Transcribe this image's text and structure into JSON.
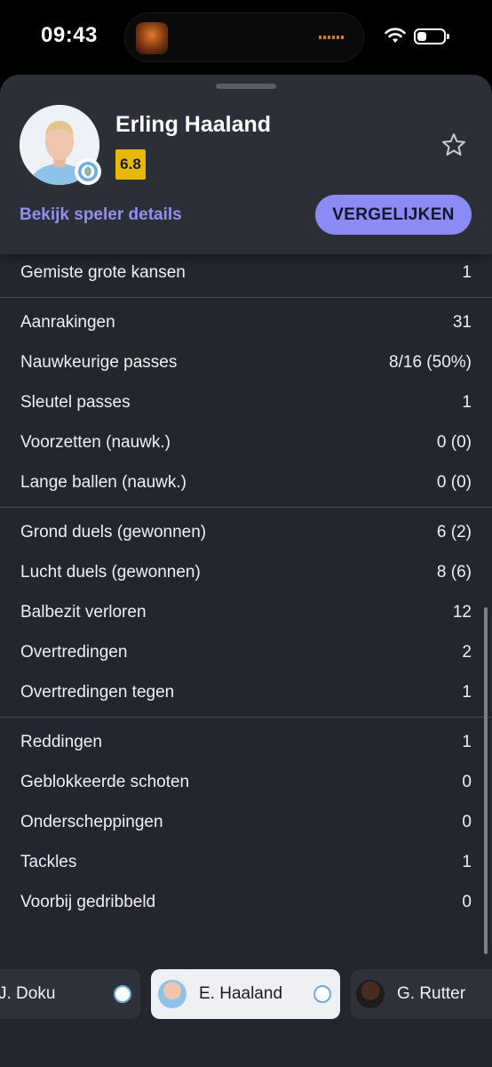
{
  "status_bar": {
    "time": "09:43",
    "battery_level": 0.35
  },
  "player": {
    "name": "Erling Haaland",
    "rating": "6.8",
    "details_link": "Bekijk speler details",
    "compare_button": "VERGELIJKEN"
  },
  "colors": {
    "accent": "#8a8bf4",
    "rating": "#e6b80a",
    "sheet": "#23262e",
    "header": "#2c2f38"
  },
  "stat_groups": [
    [
      {
        "label": "Gemiste grote kansen",
        "value": "1"
      }
    ],
    [
      {
        "label": "Aanrakingen",
        "value": "31"
      },
      {
        "label": "Nauwkeurige passes",
        "value": "8/16 (50%)"
      },
      {
        "label": "Sleutel passes",
        "value": "1"
      },
      {
        "label": "Voorzetten (nauwk.)",
        "value": "0 (0)"
      },
      {
        "label": "Lange ballen (nauwk.)",
        "value": "0 (0)"
      }
    ],
    [
      {
        "label": "Grond duels (gewonnen)",
        "value": "6 (2)"
      },
      {
        "label": "Lucht duels (gewonnen)",
        "value": "8 (6)"
      },
      {
        "label": "Balbezit verloren",
        "value": "12"
      },
      {
        "label": "Overtredingen",
        "value": "2"
      },
      {
        "label": "Overtredingen tegen",
        "value": "1"
      }
    ],
    [
      {
        "label": "Reddingen",
        "value": "1"
      },
      {
        "label": "Geblokkeerde schoten",
        "value": "0"
      },
      {
        "label": "Onderscheppingen",
        "value": "0"
      },
      {
        "label": "Tackles",
        "value": "1"
      },
      {
        "label": "Voorbij gedribbeld",
        "value": "0"
      }
    ]
  ],
  "player_strip": [
    {
      "name": "J. Doku",
      "active": false
    },
    {
      "name": "E. Haaland",
      "active": true
    },
    {
      "name": "G. Rutter",
      "active": false
    }
  ],
  "icons": [
    "wifi-icon",
    "battery-icon",
    "star-icon",
    "club-badge-icon"
  ]
}
